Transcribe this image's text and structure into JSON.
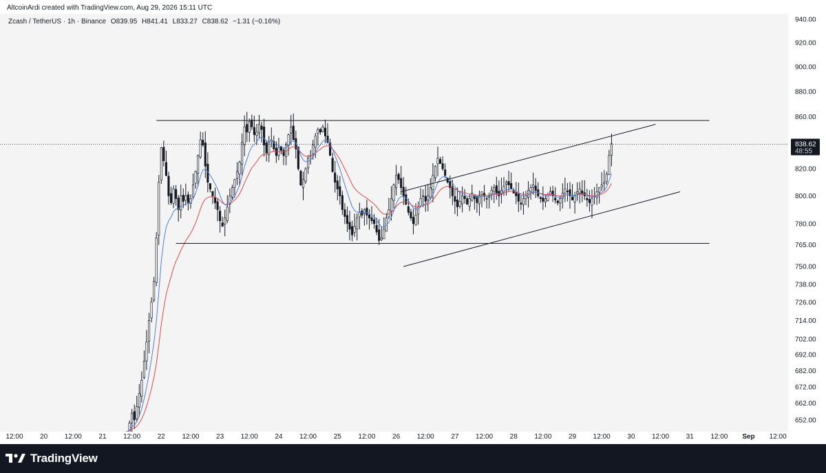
{
  "caption": {
    "author": "AltcoinArdi",
    "created_with": "created with TradingView.com,",
    "timestamp": "Aug 29, 2026 15:11 UTC"
  },
  "legend": {
    "symbol": "Zcash / TetherUS · 1h · Binance",
    "open": "O839.95",
    "high": "H841.41",
    "low": "L833.27",
    "close": "C838.62",
    "change": "−1.31 (−0.16%)"
  },
  "current_price": {
    "price": "838.62",
    "countdown": "48:55"
  },
  "footer": {
    "brand": "TradingView",
    "logo_icon": "tradingview-logo-icon"
  },
  "colors": {
    "background": "#f4f4f4",
    "candle": "#131722",
    "ma_fast": "#4c7fe0",
    "ma_slow": "#e0484c",
    "trendline": "#131722",
    "footer_bg": "#131722"
  },
  "chart_data": {
    "type": "candlestick",
    "symbol": "Zcash / TetherUS",
    "interval": "1h",
    "exchange": "Binance",
    "y_scale": "log",
    "ylim": [
      645,
      940
    ],
    "y_ticks": [
      940,
      920,
      900,
      880,
      860,
      820,
      800,
      780,
      765,
      750,
      738,
      726,
      714,
      702,
      692,
      682,
      672,
      662,
      652
    ],
    "y_tick_labels": [
      "940.00",
      "920.00",
      "900.00",
      "880.00",
      "860.00",
      "820.00",
      "800.00",
      "780.00",
      "765.00",
      "750.00",
      "738.00",
      "726.00",
      "714.00",
      "702.00",
      "692.00",
      "682.00",
      "672.00",
      "662.00",
      "652.00"
    ],
    "x_ticks": [
      {
        "label": "12:00",
        "t": 0.0
      },
      {
        "label": "20",
        "t": 12.0
      },
      {
        "label": "12:00",
        "t": 24.0
      },
      {
        "label": "21",
        "t": 36.0
      },
      {
        "label": "12:00",
        "t": 48.0
      },
      {
        "label": "22",
        "t": 60.0
      },
      {
        "label": "12:00",
        "t": 72.0
      },
      {
        "label": "23",
        "t": 84.0
      },
      {
        "label": "12:00",
        "t": 96.0
      },
      {
        "label": "24",
        "t": 108.0
      },
      {
        "label": "12:00",
        "t": 120.0
      },
      {
        "label": "25",
        "t": 132.0
      },
      {
        "label": "12:00",
        "t": 144.0
      },
      {
        "label": "26",
        "t": 156.0
      },
      {
        "label": "12:00",
        "t": 168.0
      },
      {
        "label": "27",
        "t": 180.0
      },
      {
        "label": "12:00",
        "t": 192.0
      },
      {
        "label": "28",
        "t": 204.0
      },
      {
        "label": "12:00",
        "t": 216.0
      },
      {
        "label": "29",
        "t": 228.0
      },
      {
        "label": "12:00",
        "t": 240.0
      },
      {
        "label": "30",
        "t": 252.0
      },
      {
        "label": "12:00",
        "t": 264.0
      },
      {
        "label": "31",
        "t": 276.0
      },
      {
        "label": "12:00",
        "t": 288.0
      },
      {
        "label": "Sep",
        "t": 300.0,
        "bold": true
      },
      {
        "label": "12:00",
        "t": 312.0
      }
    ],
    "last_price": 838.62,
    "close_path": [
      [
        46,
        645
      ],
      [
        47,
        650
      ],
      [
        48,
        656
      ],
      [
        49,
        652
      ],
      [
        50,
        660
      ],
      [
        51,
        668
      ],
      [
        52,
        676
      ],
      [
        53,
        688
      ],
      [
        54,
        700
      ],
      [
        55,
        714
      ],
      [
        56,
        726
      ],
      [
        57,
        740
      ],
      [
        58,
        770
      ],
      [
        59,
        810
      ],
      [
        60,
        836
      ],
      [
        61,
        826
      ],
      [
        62,
        815
      ],
      [
        63,
        800
      ],
      [
        64,
        795
      ],
      [
        65,
        805
      ],
      [
        66,
        798
      ],
      [
        67,
        790
      ],
      [
        68,
        800
      ],
      [
        69,
        796
      ],
      [
        70,
        800
      ],
      [
        71,
        795
      ],
      [
        72,
        798
      ],
      [
        73,
        808
      ],
      [
        74,
        818
      ],
      [
        75,
        830
      ],
      [
        76,
        842
      ],
      [
        77,
        838
      ],
      [
        78,
        822
      ],
      [
        79,
        810
      ],
      [
        80,
        805
      ],
      [
        81,
        800
      ],
      [
        82,
        795
      ],
      [
        83,
        790
      ],
      [
        84,
        782
      ],
      [
        85,
        778
      ],
      [
        86,
        784
      ],
      [
        87,
        792
      ],
      [
        88,
        800
      ],
      [
        89,
        806
      ],
      [
        90,
        812
      ],
      [
        91,
        818
      ],
      [
        92,
        825
      ],
      [
        93,
        840
      ],
      [
        94,
        852
      ],
      [
        95,
        848
      ],
      [
        96,
        856
      ],
      [
        97,
        852
      ],
      [
        98,
        846
      ],
      [
        99,
        848
      ],
      [
        100,
        854
      ],
      [
        101,
        850
      ],
      [
        102,
        838
      ],
      [
        103,
        832
      ],
      [
        104,
        840
      ],
      [
        105,
        842
      ],
      [
        106,
        835
      ],
      [
        107,
        830
      ],
      [
        108,
        836
      ],
      [
        109,
        834
      ],
      [
        110,
        830
      ],
      [
        111,
        838
      ],
      [
        112,
        846
      ],
      [
        113,
        852
      ],
      [
        114,
        842
      ],
      [
        115,
        835
      ],
      [
        116,
        820
      ],
      [
        117,
        808
      ],
      [
        118,
        812
      ],
      [
        119,
        820
      ],
      [
        120,
        828
      ],
      [
        121,
        830
      ],
      [
        122,
        838
      ],
      [
        123,
        845
      ],
      [
        124,
        850
      ],
      [
        125,
        848
      ],
      [
        126,
        852
      ],
      [
        127,
        845
      ],
      [
        128,
        840
      ],
      [
        129,
        830
      ],
      [
        130,
        818
      ],
      [
        131,
        810
      ],
      [
        132,
        805
      ],
      [
        133,
        800
      ],
      [
        134,
        790
      ],
      [
        135,
        785
      ],
      [
        136,
        780
      ],
      [
        137,
        776
      ],
      [
        138,
        772
      ],
      [
        139,
        778
      ],
      [
        140,
        784
      ],
      [
        141,
        788
      ],
      [
        142,
        786
      ],
      [
        143,
        790
      ],
      [
        144,
        786
      ],
      [
        145,
        784
      ],
      [
        146,
        782
      ],
      [
        147,
        780
      ],
      [
        148,
        774
      ],
      [
        149,
        768
      ],
      [
        150,
        770
      ],
      [
        151,
        776
      ],
      [
        152,
        784
      ],
      [
        153,
        790
      ],
      [
        154,
        798
      ],
      [
        155,
        808
      ],
      [
        156,
        815
      ],
      [
        157,
        812
      ],
      [
        158,
        806
      ],
      [
        159,
        800
      ],
      [
        160,
        794
      ],
      [
        161,
        788
      ],
      [
        162,
        784
      ],
      [
        163,
        780
      ],
      [
        164,
        786
      ],
      [
        165,
        792
      ],
      [
        166,
        798
      ],
      [
        167,
        800
      ],
      [
        168,
        796
      ],
      [
        169,
        800
      ],
      [
        170,
        806
      ],
      [
        171,
        815
      ],
      [
        172,
        822
      ],
      [
        173,
        828
      ],
      [
        174,
        824
      ],
      [
        175,
        820
      ],
      [
        176,
        815
      ],
      [
        177,
        810
      ],
      [
        178,
        806
      ],
      [
        179,
        800
      ],
      [
        180,
        796
      ],
      [
        181,
        792
      ],
      [
        182,
        796
      ],
      [
        183,
        800
      ],
      [
        184,
        798
      ],
      [
        185,
        794
      ],
      [
        186,
        798
      ],
      [
        187,
        802
      ],
      [
        188,
        798
      ],
      [
        189,
        795
      ],
      [
        190,
        800
      ],
      [
        191,
        803
      ],
      [
        192,
        800
      ],
      [
        193,
        798
      ],
      [
        194,
        800
      ],
      [
        195,
        804
      ],
      [
        196,
        806
      ],
      [
        197,
        802
      ],
      [
        198,
        800
      ],
      [
        199,
        804
      ],
      [
        200,
        807
      ],
      [
        201,
        810
      ],
      [
        202,
        808
      ],
      [
        203,
        805
      ],
      [
        204,
        802
      ],
      [
        205,
        800
      ],
      [
        206,
        796
      ],
      [
        207,
        794
      ],
      [
        208,
        798
      ],
      [
        209,
        800
      ],
      [
        210,
        804
      ],
      [
        211,
        806
      ],
      [
        212,
        808
      ],
      [
        213,
        804
      ],
      [
        214,
        800
      ],
      [
        215,
        798
      ],
      [
        216,
        796
      ],
      [
        217,
        798
      ],
      [
        218,
        801
      ],
      [
        219,
        803
      ],
      [
        220,
        800
      ],
      [
        221,
        797
      ],
      [
        222,
        795
      ],
      [
        223,
        798
      ],
      [
        224,
        802
      ],
      [
        225,
        805
      ],
      [
        226,
        803
      ],
      [
        227,
        800
      ],
      [
        228,
        797
      ],
      [
        229,
        800
      ],
      [
        230,
        803
      ],
      [
        231,
        805
      ],
      [
        232,
        802
      ],
      [
        233,
        800
      ],
      [
        234,
        797
      ],
      [
        235,
        795
      ],
      [
        236,
        798
      ],
      [
        237,
        800
      ],
      [
        238,
        803
      ],
      [
        239,
        806
      ],
      [
        240,
        808
      ],
      [
        241,
        810
      ],
      [
        242,
        816
      ],
      [
        243,
        830
      ],
      [
        244,
        839
      ]
    ],
    "ma_fast_name": "",
    "ma_slow_name": "",
    "resistance": {
      "price": 857.0,
      "t_start": 58,
      "t_end": 284
    },
    "support": {
      "price": 766.0,
      "t_start": 66,
      "t_end": 284
    },
    "channel_upper": {
      "t1": 158,
      "p1": 803,
      "t2": 262,
      "p2": 854
    },
    "channel_lower": {
      "t1": 159,
      "p1": 750,
      "t2": 272,
      "p2": 803
    },
    "grid": false,
    "legend_position": "top-left"
  }
}
